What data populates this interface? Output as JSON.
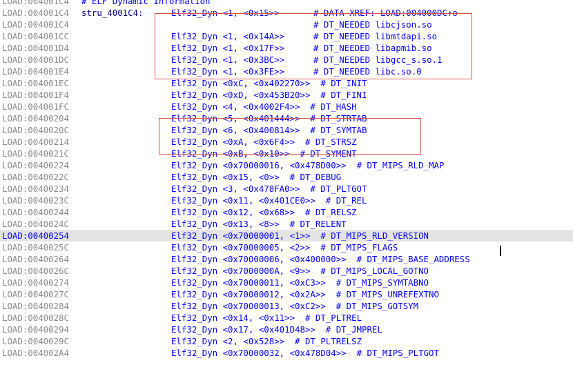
{
  "header_comment": "# ELF Dynamic Information",
  "rows": [
    {
      "addr": "LOAD:004001C4",
      "label": "",
      "instr": "",
      "comment": "",
      "top": true
    },
    {
      "addr": "LOAD:004001C4",
      "label": "stru_4001C4:",
      "instr": "Elf32_Dyn <1, <0x15>>",
      "comment": "# DATA XREF: LOAD:004000DC↑o"
    },
    {
      "addr": "LOAD:004001C4",
      "label": "",
      "instr": "",
      "comment": "# DT_NEEDED libcjson.so"
    },
    {
      "addr": "LOAD:004001CC",
      "label": "",
      "instr": "Elf32_Dyn <1, <0x14A>>",
      "comment": "# DT_NEEDED libmtdapi.so"
    },
    {
      "addr": "LOAD:004001D4",
      "label": "",
      "instr": "Elf32_Dyn <1, <0x17F>>",
      "comment": "# DT_NEEDED libapmib.so"
    },
    {
      "addr": "LOAD:004001DC",
      "label": "",
      "instr": "Elf32_Dyn <1, <0x3BC>>",
      "comment": "# DT_NEEDED libgcc_s.so.1"
    },
    {
      "addr": "LOAD:004001E4",
      "label": "",
      "instr": "Elf32_Dyn <1, <0x3FE>>",
      "comment": "# DT_NEEDED libc.so.0"
    },
    {
      "addr": "LOAD:004001EC",
      "label": "",
      "instr": "Elf32_Dyn <0xC, <0x402270>>",
      "comment": "# DT_INIT"
    },
    {
      "addr": "LOAD:004001F4",
      "label": "",
      "instr": "Elf32_Dyn <0xD, <0x453B20>>",
      "comment": "# DT_FINI"
    },
    {
      "addr": "LOAD:004001FC",
      "label": "",
      "instr": "Elf32_Dyn <4, <0x4002F4>>",
      "comment": "# DT_HASH"
    },
    {
      "addr": "LOAD:00400204",
      "label": "",
      "instr": "Elf32_Dyn <5, <0x401444>>",
      "comment": "# DT_STRTAB"
    },
    {
      "addr": "LOAD:0040020C",
      "label": "",
      "instr": "Elf32_Dyn <6, <0x400814>>",
      "comment": "# DT_SYMTAB"
    },
    {
      "addr": "LOAD:00400214",
      "label": "",
      "instr": "Elf32_Dyn <0xA, <0x6F4>>",
      "comment": "# DT_STRSZ"
    },
    {
      "addr": "LOAD:0040021C",
      "label": "",
      "instr": "Elf32_Dyn <0xB, <0x10>>",
      "comment": "# DT_SYMENT"
    },
    {
      "addr": "LOAD:00400224",
      "label": "",
      "instr": "Elf32_Dyn <0x70000016, <0x478D00>>",
      "comment": "# DT_MIPS_RLD_MAP"
    },
    {
      "addr": "LOAD:0040022C",
      "label": "",
      "instr": "Elf32_Dyn <0x15, <0>>",
      "comment": "# DT_DEBUG"
    },
    {
      "addr": "LOAD:00400234",
      "label": "",
      "instr": "Elf32_Dyn <3, <0x478FA0>>",
      "comment": "# DT_PLTGOT"
    },
    {
      "addr": "LOAD:0040023C",
      "label": "",
      "instr": "Elf32_Dyn <0x11, <0x401CE0>>",
      "comment": "# DT_REL"
    },
    {
      "addr": "LOAD:00400244",
      "label": "",
      "instr": "Elf32_Dyn <0x12, <0x68>>",
      "comment": "# DT_RELSZ"
    },
    {
      "addr": "LOAD:0040024C",
      "label": "",
      "instr": "Elf32_Dyn <0x13, <8>>",
      "comment": "# DT_RELENT"
    },
    {
      "addr": "LOAD:00400254",
      "label": "",
      "instr": "Elf32_Dyn <0x70000001, <1>>",
      "comment": "# DT_MIPS_RLD_VERSION",
      "current": true
    },
    {
      "addr": "LOAD:0040025C",
      "label": "",
      "instr": "Elf32_Dyn <0x70000005, <2>>",
      "comment": "# DT_MIPS_FLAGS"
    },
    {
      "addr": "LOAD:00400264",
      "label": "",
      "instr": "Elf32_Dyn <0x70000006, <0x400000>>",
      "comment": "# DT_MIPS_BASE_ADDRESS"
    },
    {
      "addr": "LOAD:0040026C",
      "label": "",
      "instr": "Elf32_Dyn <0x7000000A, <9>>",
      "comment": "# DT_MIPS_LOCAL_GOTNO"
    },
    {
      "addr": "LOAD:00400274",
      "label": "",
      "instr": "Elf32_Dyn <0x70000011, <0xC3>>",
      "comment": "# DT_MIPS_SYMTABNO"
    },
    {
      "addr": "LOAD:0040027C",
      "label": "",
      "instr": "Elf32_Dyn <0x70000012, <0x2A>>",
      "comment": "# DT_MIPS_UNREFEXTNO"
    },
    {
      "addr": "LOAD:00400284",
      "label": "",
      "instr": "Elf32_Dyn <0x70000013, <0xC2>>",
      "comment": "# DT_MIPS_GOTSYM"
    },
    {
      "addr": "LOAD:0040028C",
      "label": "",
      "instr": "Elf32_Dyn <0x14, <0x11>>",
      "comment": "# DT_PLTREL"
    },
    {
      "addr": "LOAD:00400294",
      "label": "",
      "instr": "Elf32_Dyn <0x17, <0x401D48>>",
      "comment": "# DT_JMPREL"
    },
    {
      "addr": "LOAD:0040029C",
      "label": "",
      "instr": "Elf32_Dyn <2, <0x528>>",
      "comment": "# DT_PLTRELSZ"
    },
    {
      "addr": "LOAD:004002A4",
      "label": "",
      "instr": "Elf32_Dyn <0x70000032, <0x478D04>>",
      "comment": "# DT_MIPS_PLTGOT"
    }
  ],
  "colors": {
    "address": "#8a8a8a",
    "current_address": "#0000ff",
    "code": "#0000ff",
    "label": "#00007f",
    "highlight_box": "#d9534f",
    "current_line_bg": "#e4e4e4"
  }
}
